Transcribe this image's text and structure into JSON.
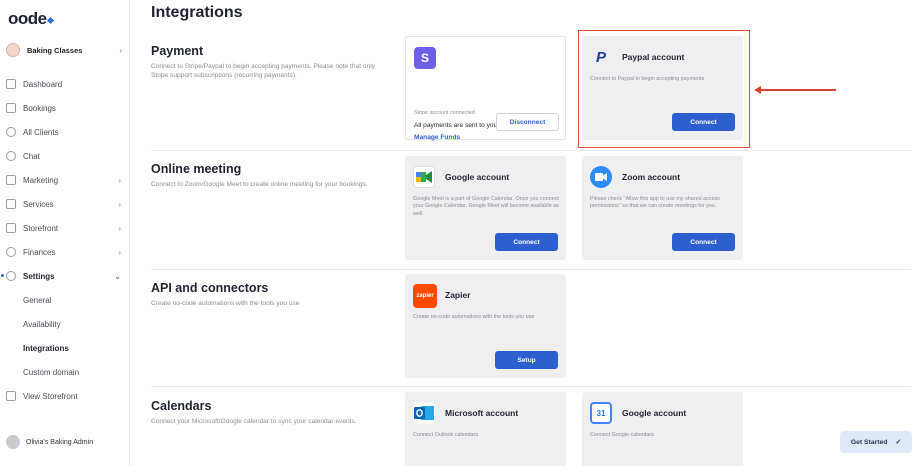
{
  "app": {
    "logo": "oode",
    "page_title": "Integrations",
    "business_name": "Baking Classes",
    "user_name": "Olivia's Baking Admin"
  },
  "sidebar": {
    "items": [
      {
        "label": "Dashboard",
        "icon": "dashboard-icon"
      },
      {
        "label": "Bookings",
        "icon": "calendar-icon"
      },
      {
        "label": "All Clients",
        "icon": "clients-icon"
      },
      {
        "label": "Chat",
        "icon": "chat-icon"
      },
      {
        "label": "Marketing",
        "icon": "megaphone-icon",
        "chevron": "›"
      },
      {
        "label": "Services",
        "icon": "services-icon",
        "chevron": "›"
      },
      {
        "label": "Storefront",
        "icon": "store-icon",
        "chevron": "›"
      },
      {
        "label": "Finances",
        "icon": "finances-icon",
        "chevron": "›"
      },
      {
        "label": "Settings",
        "icon": "gear-icon",
        "chevron": "⌄"
      }
    ],
    "settings_sub": [
      {
        "label": "General"
      },
      {
        "label": "Availability"
      },
      {
        "label": "Integrations"
      },
      {
        "label": "Custom domain"
      }
    ],
    "view_storefront": "View Storefront"
  },
  "sections": {
    "payment": {
      "title": "Payment",
      "desc": "Connect to Stripe/Paypal to begin accepting payments. Please note that only Stripe support subscriptions (recurring payments)."
    },
    "online_meeting": {
      "title": "Online meeting",
      "desc": "Connect to Zoom/Google Meet to create online meeting for your bookings."
    },
    "api": {
      "title": "API and connectors",
      "desc": "Create no-code automations with the tools you use"
    },
    "calendars": {
      "title": "Calendars",
      "desc": "Connect your Microsoft/Google calendar to sync your calendar events."
    }
  },
  "cards": {
    "stripe": {
      "icon_letter": "S",
      "status": "Stripe account connected",
      "message": "All payments are sent to your Stripe account.",
      "link": "Manage Funds",
      "button": "Disconnect"
    },
    "paypal": {
      "icon_letter": "P",
      "name": "Paypal account",
      "desc": "Connect to Paypal to begin accepting payments",
      "button": "Connect"
    },
    "google": {
      "name": "Google account",
      "desc": "Google Meet is a part of Google Calendar. Once you connect your Google Calendar, Google Meet will become available as well.",
      "button": "Connect"
    },
    "zoom": {
      "name": "Zoom account",
      "desc": "Please check \"Allow this app to use my shared access permissions\" so that we can create meetings for you.",
      "button": "Connect"
    },
    "zapier": {
      "icon_text": "zapier",
      "name": "Zapier",
      "desc": "Create no-code automations with the tools you use",
      "button": "Setup"
    },
    "microsoft": {
      "name": "Microsoft account",
      "desc": "Connect Outlook calendars"
    },
    "google_cal": {
      "icon_text": "31",
      "name": "Google account",
      "desc": "Connect Google calendars"
    }
  },
  "get_started": {
    "label": "Get Started",
    "check": "✓"
  },
  "colors": {
    "primary": "#2d5fcf",
    "highlight": "#e0503a"
  }
}
